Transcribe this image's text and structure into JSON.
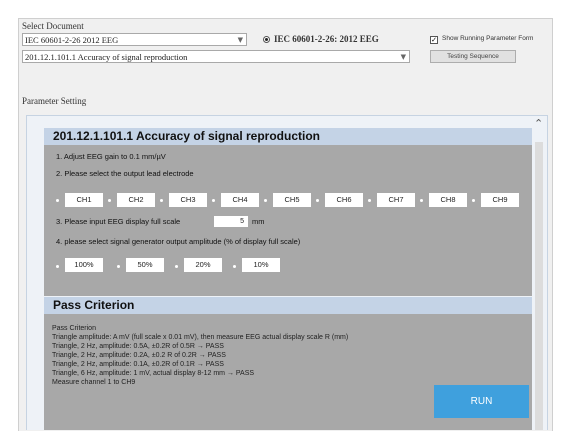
{
  "document": {
    "select_label": "Select Document",
    "standard_value": "IEC 60601-2-26 2012 EEG",
    "standard_radio_label": "IEC 60601-2-26: 2012 EEG",
    "clause_value": "201.12.1.101.1   Accuracy of signal reproduction",
    "show_form_label": "Show Running Parameter Form",
    "show_form_checked": true,
    "testing_sequence_label": "Testing Sequence"
  },
  "params": {
    "section_label": "Parameter Setting",
    "title": "201.12.1.101.1 Accuracy of signal reproduction",
    "step1": "1. Adjust EEG gain to 0.1 mm/µV",
    "step2": "2. Please select the output lead electrode",
    "channels": [
      "CH1",
      "CH2",
      "CH3",
      "CH4",
      "CH5",
      "CH6",
      "CH7",
      "CH8",
      "CH9"
    ],
    "step3": "3. Please input EEG display full scale",
    "full_scale_value": "5",
    "full_scale_unit": "mm",
    "step4": "4. please select signal generator output amplitude (% of display full scale)",
    "amplitudes": [
      "100%",
      "50%",
      "20%",
      "10%"
    ]
  },
  "pass": {
    "title": "Pass Criterion",
    "lines": [
      "Pass Criterion",
      "Triangle amplitude: A mV (full scale x 0.01 mV), then measure EEG actual display scale R (mm)",
      "Triangle, 2 Hz, amplitude: 0.5A, ±0.2R of 0.5R → PASS",
      "Triangle, 2 Hz, amplitude: 0.2A, ±0.2 R of 0.2R → PASS",
      "Triangle, 2 Hz, amplitude: 0.1A, ±0.2R of 0.1R → PASS",
      "Triangle, 6 Hz, amplitude: 1 mV, actual display 8-12 mm → PASS",
      "Measure channel 1 to CH9"
    ],
    "run_label": "RUN"
  }
}
